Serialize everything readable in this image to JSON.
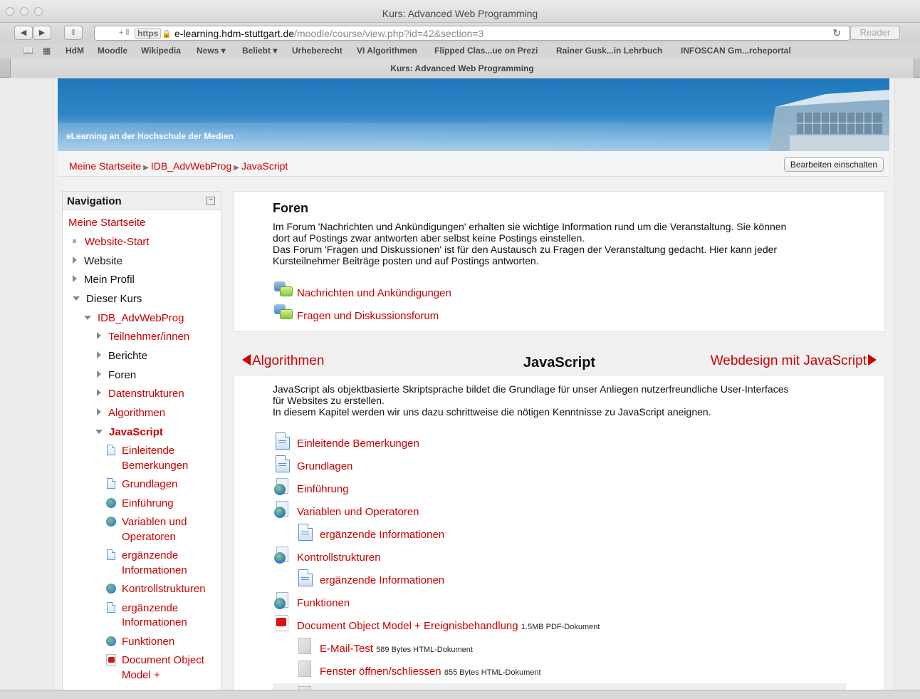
{
  "browser": {
    "window_title": "Kurs: Advanced Web Programming",
    "url_proto": "https",
    "url_host": "e-learning.hdm-stuttgart.de",
    "url_path": "/moodle/course/view.php?id=42&section=3",
    "reader_label": "Reader",
    "tab_title": "Kurs: Advanced Web Programming",
    "bookmarks": [
      "HdM",
      "Moodle",
      "Wikipedia",
      "News ▾",
      "Beliebt ▾",
      "Urheberecht",
      "VI Algorithmen",
      "Flipped Clas...ue on Prezi",
      "Rainer Gusk...in Lehrbuch",
      "INFOSCAN Gm...rcheportal"
    ]
  },
  "header": {
    "banner_title": "eLearning an der Hochschule der Medien",
    "breadcrumb": [
      "Meine Startseite",
      "IDB_AdvWebProg",
      "JavaScript"
    ],
    "edit_button": "Bearbeiten einschalten"
  },
  "navigation": {
    "title": "Navigation",
    "items": [
      "Meine Startseite",
      "Website-Start",
      "Website",
      "Mein Profil",
      "Dieser Kurs",
      "IDB_AdvWebProg",
      "Teilnehmer/innen",
      "Berichte",
      "Foren",
      "Datenstrukturen",
      "Algorithmen",
      "JavaScript",
      "Einleitende",
      "Bemerkungen",
      "Grundlagen",
      "Einführung",
      "Variablen und",
      "Operatoren",
      "ergänzende",
      "Informationen",
      "Kontrollstrukturen",
      "ergänzende",
      "Informationen",
      "Funktionen",
      "Document Object",
      "Model +"
    ]
  },
  "forums": {
    "title": "Foren",
    "text1": "Im Forum 'Nachrichten und Ankündigungen' erhalten sie wichtige Information rund um die Veranstaltung. Sie können",
    "text2": "dort auf Postings zwar antworten aber selbst keine Postings einstellen.",
    "text3": "Das Forum 'Fragen und Diskussionen' ist für den Austausch zu Fragen der Veranstaltung gedacht. Hier kann jeder",
    "text4": "Kursteilnehmer Beiträge posten und auf Postings antworten.",
    "links": [
      "Nachrichten und Ankündigungen",
      "Fragen und Diskussionsforum"
    ]
  },
  "section_nav": {
    "prev": "Algorithmen",
    "current": "JavaScript",
    "next": "Webdesign mit JavaScript"
  },
  "javascript": {
    "text1": "JavaScript als objektbasierte Skriptsprache bildet die Grundlage für unser Anliegen nutzerfreundliche User-Interfaces",
    "text2": "für Websites zu erstellen.",
    "text3": "In diesem Kapitel werden wir uns dazu schrittweise die nötigen Kenntnisse zu JavaScript aneignen.",
    "activities": [
      {
        "label": "Einleitende Bemerkungen",
        "icon": "page-icon"
      },
      {
        "label": "Grundlagen",
        "icon": "page-icon"
      },
      {
        "label": "Einführung",
        "icon": "url-globe-icon"
      },
      {
        "label": "Variablen und Operatoren",
        "icon": "url-globe-icon"
      },
      {
        "label": "ergänzende Informationen",
        "icon": "page-icon"
      },
      {
        "label": "Kontrollstrukturen",
        "icon": "url-globe-icon"
      },
      {
        "label": "ergänzende Informationen",
        "icon": "page-icon"
      },
      {
        "label": "Funktionen",
        "icon": "url-globe-icon"
      },
      {
        "label": "Document Object Model + Ereignisbehandlung",
        "meta": "1.5MB PDF-Dokument",
        "icon": "pdf-icon"
      },
      {
        "label": "E-Mail-Test",
        "meta": "589 Bytes HTML-Dokument",
        "icon": "file-icon"
      },
      {
        "label": "Fenster öffnen/schliessen",
        "meta": "855 Bytes HTML-Dokument",
        "icon": "file-icon"
      }
    ]
  },
  "colors": {
    "link": "#cc0000",
    "banner": "#2f86c6"
  }
}
